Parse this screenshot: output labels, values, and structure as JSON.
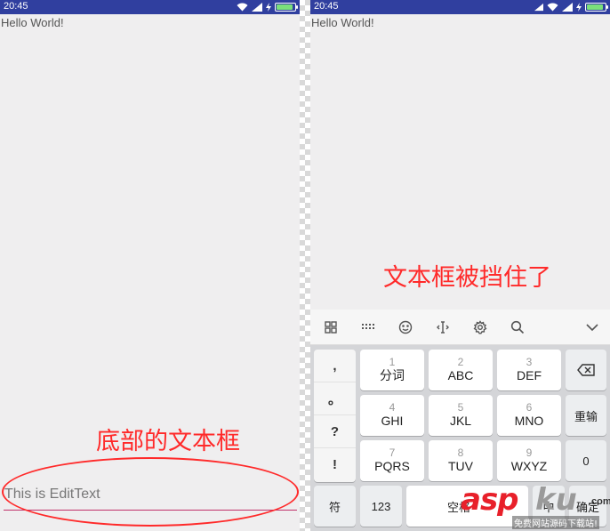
{
  "status_bar": {
    "time": "20:45"
  },
  "app": {
    "hello_text": "Hello World!"
  },
  "left_screen": {
    "annotation": "底部的文本框",
    "edit_text_value": "This is EditText"
  },
  "right_screen": {
    "annotation": "文本框被挡住了"
  },
  "keyboard": {
    "toolbar_icons": [
      "grid-icon",
      "keyboard-icon",
      "emoji-icon",
      "cursor-icon",
      "settings-icon",
      "search-icon",
      "chevron-down-icon"
    ],
    "symbols": [
      ",",
      "。",
      "?",
      "!"
    ],
    "keys": {
      "k1": {
        "num": "1",
        "letters": "分词"
      },
      "k2": {
        "num": "2",
        "letters": "ABC"
      },
      "k3": {
        "num": "3",
        "letters": "DEF"
      },
      "k4": {
        "num": "4",
        "letters": "GHI"
      },
      "k5": {
        "num": "5",
        "letters": "JKL"
      },
      "k6": {
        "num": "6",
        "letters": "MNO"
      },
      "k7": {
        "num": "7",
        "letters": "PQRS"
      },
      "k8": {
        "num": "8",
        "letters": "TUV"
      },
      "k9": {
        "num": "9",
        "letters": "WXYZ"
      }
    },
    "reinput_label": "重输",
    "zero_label": "0",
    "symbol_label": "符",
    "num_label": "123",
    "space_label": "空格",
    "lang_label": "中",
    "enter_label": "确定"
  },
  "watermark": {
    "brand_red": "asp",
    "brand_gray": "ku",
    "domain": ".com",
    "slogan": "免费网站源码下载站!"
  },
  "colors": {
    "status_bar": "#303f9f",
    "annotation": "#ff2a2a",
    "edittext_underline": "#c0316a"
  }
}
